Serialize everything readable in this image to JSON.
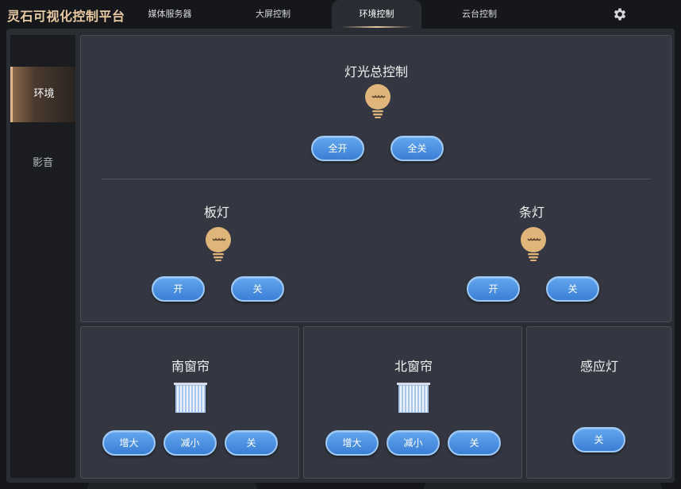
{
  "app": {
    "title": "灵石可视化控制平台"
  },
  "nav": {
    "tabs": [
      {
        "label": "媒体服务器",
        "active": false
      },
      {
        "label": "大屏控制",
        "active": false
      },
      {
        "label": "环境控制",
        "active": true
      },
      {
        "label": "云台控制",
        "active": false
      }
    ],
    "settings_icon": "gear-icon"
  },
  "sidebar": {
    "items": [
      {
        "label": "环境",
        "active": true
      },
      {
        "label": "影音",
        "active": false
      }
    ]
  },
  "lighting": {
    "title": "灯光总控制",
    "icon": "bulb-icon",
    "all_on_label": "全开",
    "all_off_label": "全关",
    "groups": [
      {
        "title": "板灯",
        "on_label": "开",
        "off_label": "关"
      },
      {
        "title": "条灯",
        "on_label": "开",
        "off_label": "关"
      }
    ]
  },
  "curtains": [
    {
      "title": "南窗帘",
      "icon": "curtain-icon",
      "up_label": "增大",
      "down_label": "减小",
      "off_label": "关"
    },
    {
      "title": "北窗帘",
      "icon": "curtain-icon",
      "up_label": "增大",
      "down_label": "减小",
      "off_label": "关"
    }
  ],
  "sensor_light": {
    "title": "感应灯",
    "off_label": "关"
  },
  "colors": {
    "accent_gold": "#e8c9a0",
    "button_blue": "#4a90e2",
    "panel_bg": "#343741",
    "page_bg": "#15171b"
  }
}
